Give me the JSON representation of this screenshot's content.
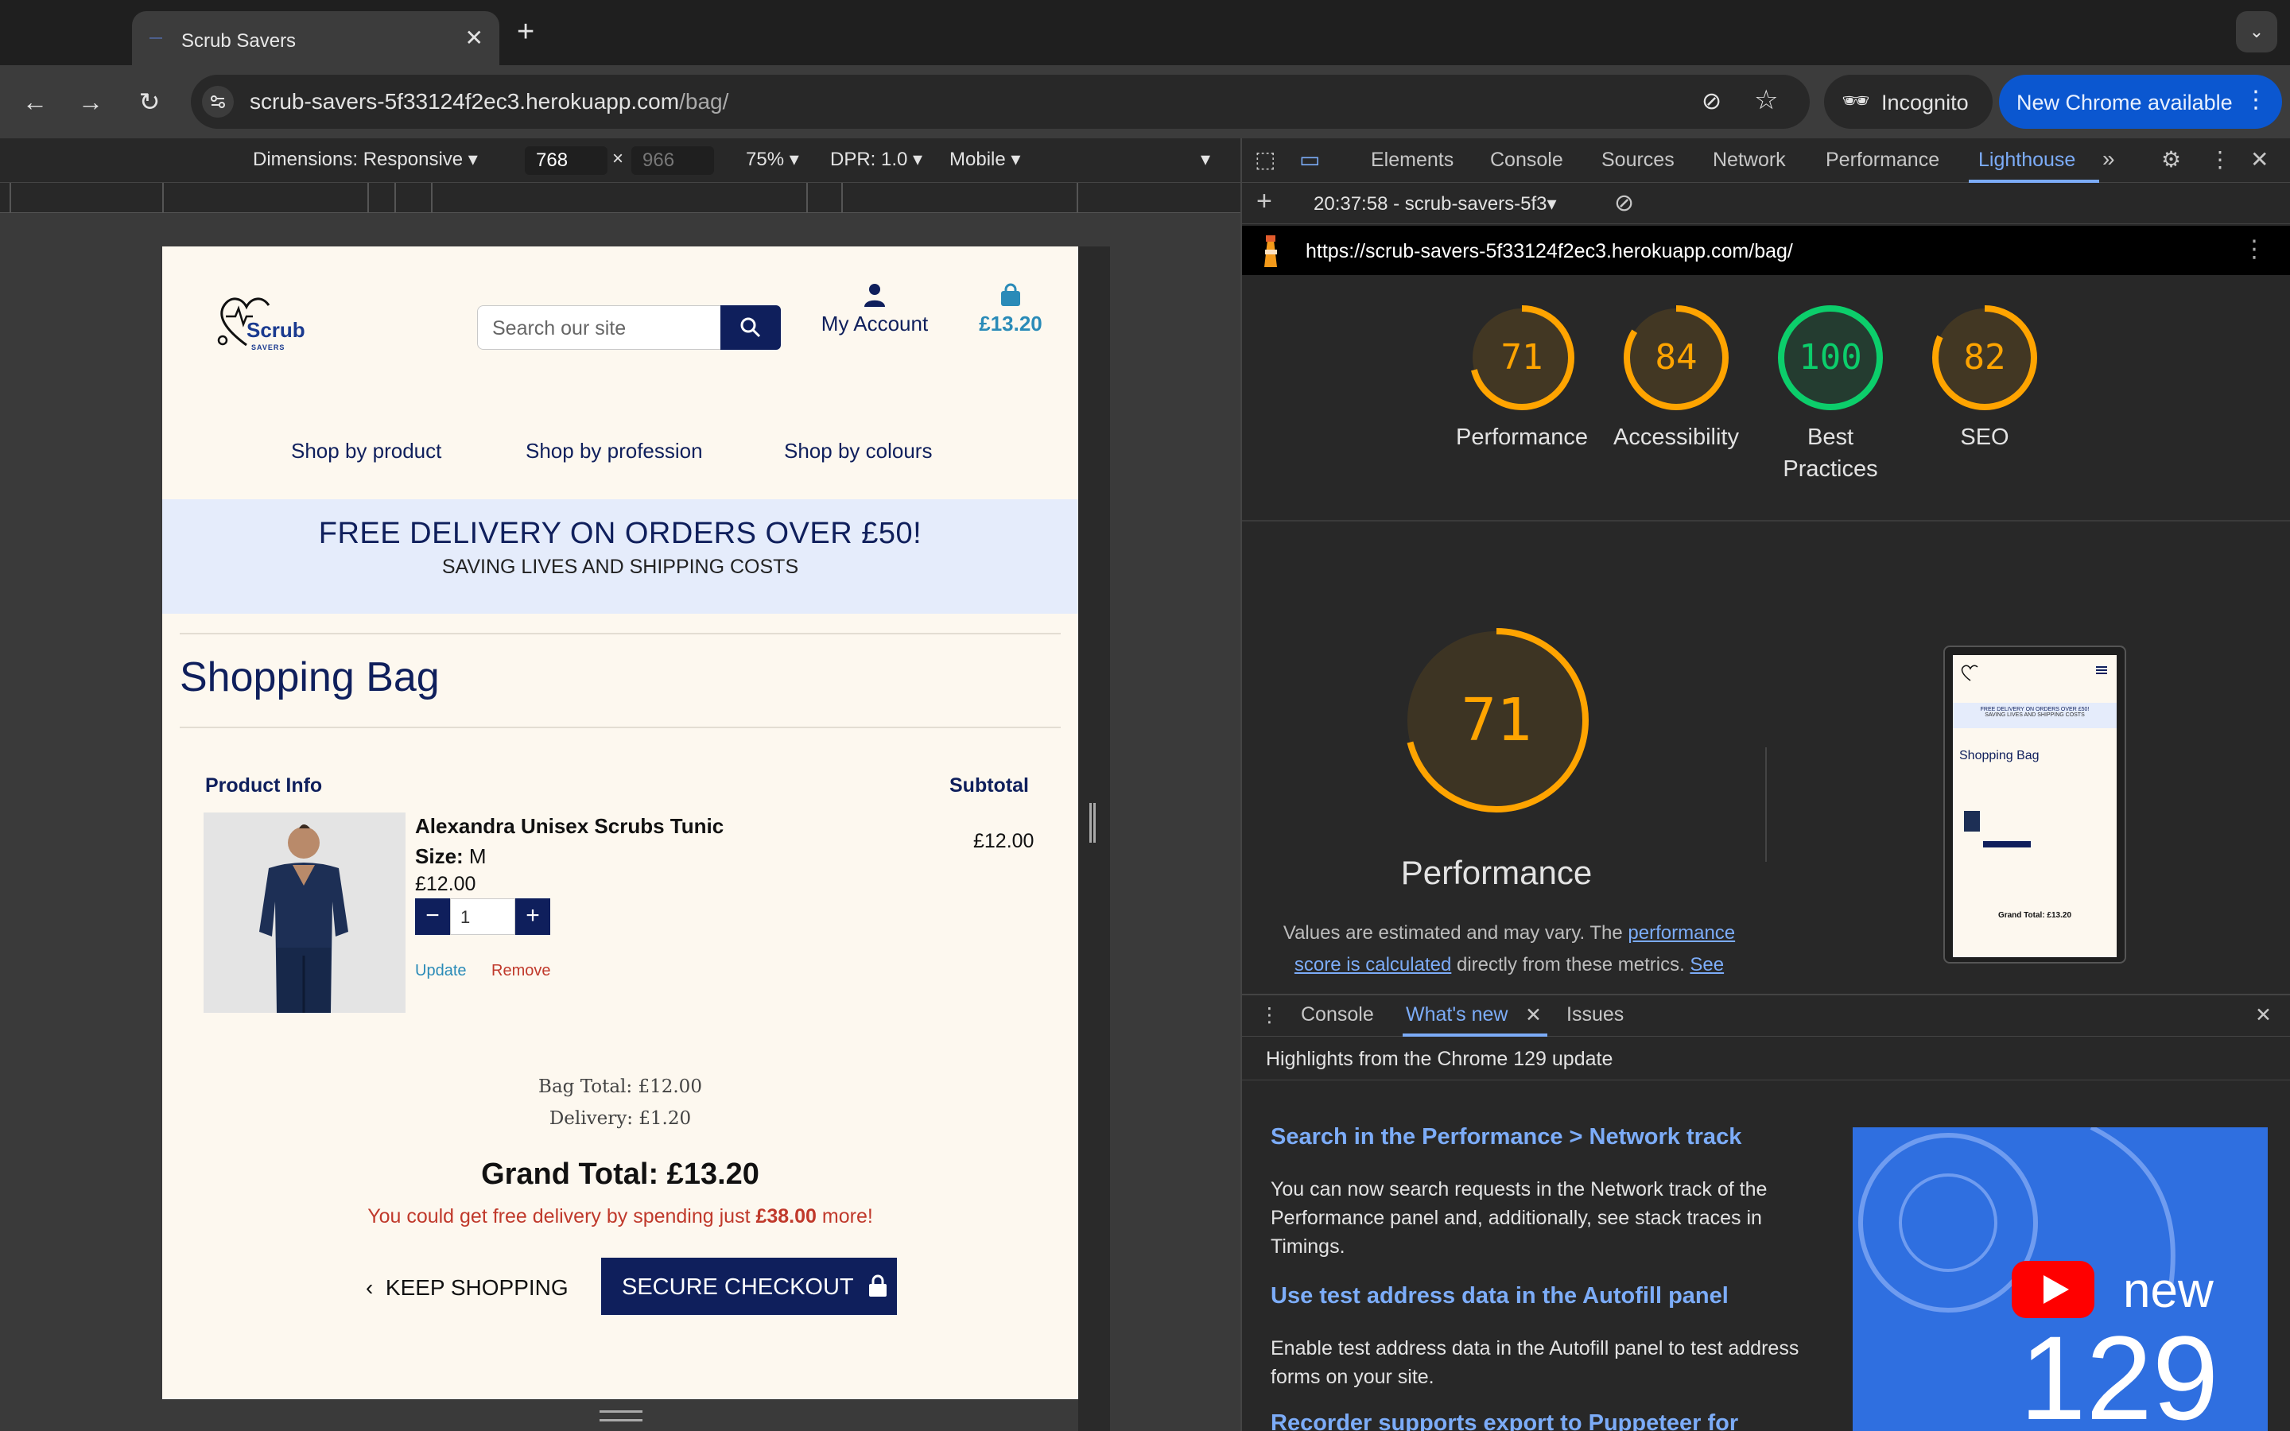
{
  "browser": {
    "tab_title": "Scrub Savers",
    "url_host": "scrub-savers-5f33124f2ec3.herokuapp.com",
    "url_path": "/bag/",
    "incognito_label": "Incognito",
    "update_label": "New Chrome available"
  },
  "device_toolbar": {
    "dimensions": "Dimensions: Responsive",
    "width": "768",
    "height": "966",
    "zoom": "75%",
    "dpr": "DPR: 1.0",
    "mode": "Mobile"
  },
  "site": {
    "logo_text": "Scrub",
    "logo_sub": "SAVERS",
    "search_placeholder": "Search our site",
    "account_label": "My Account",
    "bag_total": "£13.20",
    "nav": [
      "Shop by product",
      "Shop by profession",
      "Shop by colours"
    ],
    "promo_title": "FREE DELIVERY ON ORDERS OVER £50!",
    "promo_sub": "SAVING LIVES AND SHIPPING COSTS",
    "page_title": "Shopping Bag",
    "col_product": "Product Info",
    "col_subtotal": "Subtotal",
    "item": {
      "name": "Alexandra Unisex Scrubs Tunic",
      "size_label": "Size:",
      "size": "M",
      "price": "£12.00",
      "qty": "1",
      "subtotal": "£12.00",
      "update": "Update",
      "remove": "Remove"
    },
    "bag_total_line": "Bag Total: £12.00",
    "delivery_line": "Delivery: £1.20",
    "grand_total": "Grand Total: £13.20",
    "free_msg_prefix": "You could get free delivery by spending just ",
    "free_msg_amount": "£38.00",
    "free_msg_suffix": " more!",
    "keep_shopping": "KEEP SHOPPING",
    "checkout": "SECURE CHECKOUT"
  },
  "devtools": {
    "tabs": [
      "Elements",
      "Console",
      "Sources",
      "Network",
      "Performance",
      "Lighthouse"
    ],
    "active_tab": "Lighthouse",
    "report_label": "20:37:58 - scrub-savers-5f3",
    "report_url": "https://scrub-savers-5f33124f2ec3.herokuapp.com/bag/",
    "scores": [
      {
        "value": 71,
        "label": "Performance",
        "color": "#ffa400"
      },
      {
        "value": 84,
        "label": "Accessibility",
        "color": "#ffa400"
      },
      {
        "value": 100,
        "label": "Best Practices",
        "color": "#0cce6b"
      },
      {
        "value": 82,
        "label": "SEO",
        "color": "#ffa400"
      }
    ],
    "big_score": 71,
    "big_label": "Performance",
    "desc_1": "Values are estimated and may vary. The ",
    "desc_link_1": "performance score is calculated",
    "desc_2": " directly from these metrics. ",
    "desc_link_2": "See calculator."
  },
  "drawer": {
    "tabs": [
      "Console",
      "What's new",
      "Issues"
    ],
    "active_tab": "What's new",
    "subtitle": "Highlights from the Chrome 129 update",
    "items": [
      {
        "title": "Search in the Performance > Network track",
        "body": "You can now search requests in the Network track of the Performance panel and, additionally, see stack traces in Timings."
      },
      {
        "title": "Use test address data in the Autofill panel",
        "body": "Enable test address data in the Autofill panel to test address forms on your site."
      },
      {
        "title": "Recorder supports export to Puppeteer for",
        "body": ""
      }
    ],
    "video_new": "new",
    "video_version": "129"
  },
  "thumbnail": {
    "promo": "FREE DELIVERY ON ORDERS OVER £50!",
    "promo_sub": "SAVING LIVES AND SHIPPING COSTS",
    "title": "Shopping Bag",
    "grand": "Grand Total: £13.20"
  }
}
